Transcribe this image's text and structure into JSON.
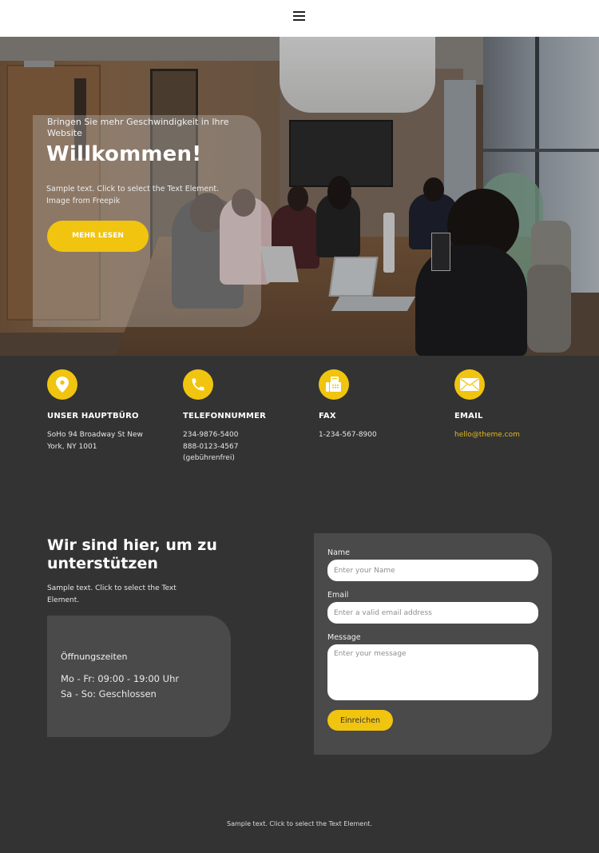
{
  "header": {
    "menu_icon": "hamburger-menu-icon"
  },
  "hero": {
    "subtitle": "Bringen Sie mehr Geschwindigkeit in Ihre Website",
    "title": "Willkommen!",
    "text": "Sample text. Click to select the Text Element. Image from Freepik",
    "button_label": "MEHR LESEN",
    "image_description": "team meeting in conference room"
  },
  "info": [
    {
      "icon": "location-pin-icon",
      "label": "UNSER HAUPTBÜRO",
      "lines": [
        "SoHo 94 Broadway St New",
        "York, NY 1001"
      ]
    },
    {
      "icon": "phone-icon",
      "label": "TELEFONNUMMER",
      "lines": [
        "234-9876-5400",
        "888-0123-4567",
        "(gebührenfrei)"
      ]
    },
    {
      "icon": "fax-icon",
      "label": "FAX",
      "lines": [
        "1-234-567-8900"
      ]
    },
    {
      "icon": "envelope-icon",
      "label": "EMAIL",
      "lines": [
        "hello@theme.com"
      ]
    }
  ],
  "support": {
    "title": "Wir sind hier, um zu unterstützen",
    "text": "Sample text. Click to select the Text Element.",
    "hours": {
      "title": "Öffnungszeiten",
      "lines": [
        "Mo - Fr: 09:00 - 19:00 Uhr",
        "Sa - So: Geschlossen"
      ]
    }
  },
  "form": {
    "name_label": "Name",
    "name_placeholder": "Enter your Name",
    "email_label": "Email",
    "email_placeholder": "Enter a valid email address",
    "message_label": "Message",
    "message_placeholder": "Enter your message",
    "submit_label": "Einreichen"
  },
  "footer": {
    "text": "Sample text. Click to select the Text Element."
  },
  "colors": {
    "accent": "#f1c40f",
    "background": "#333333",
    "panel": "#4a4a4a",
    "header": "#ffffff"
  }
}
